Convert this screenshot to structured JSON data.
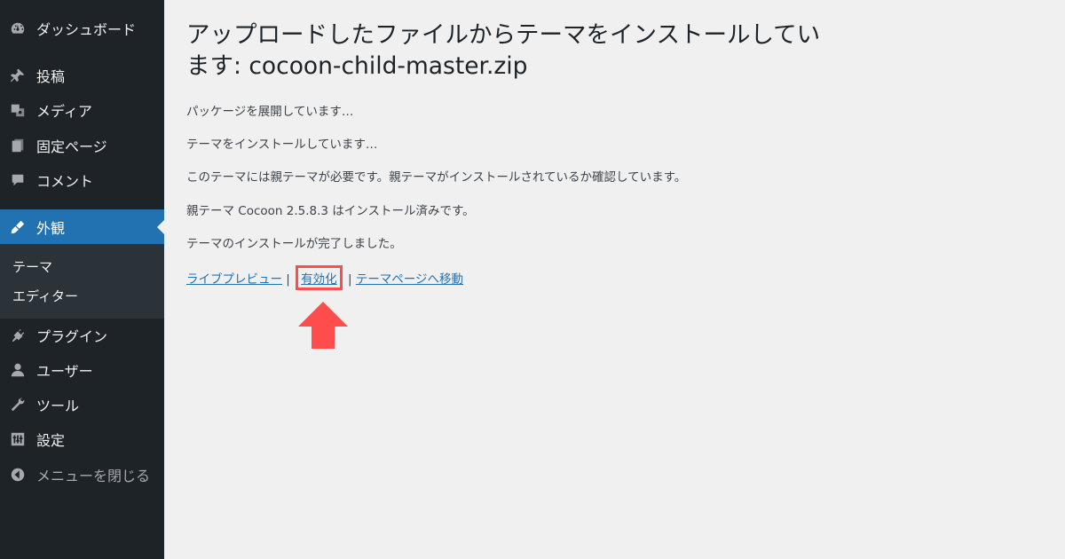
{
  "sidebar": {
    "items": [
      {
        "label": "ダッシュボード",
        "icon": "dashboard-icon"
      },
      {
        "label": "投稿",
        "icon": "pushpin-icon"
      },
      {
        "label": "メディア",
        "icon": "media-icon"
      },
      {
        "label": "固定ページ",
        "icon": "page-icon"
      },
      {
        "label": "コメント",
        "icon": "comment-icon"
      },
      {
        "label": "外観",
        "icon": "appearance-icon",
        "active": true
      },
      {
        "label": "プラグイン",
        "icon": "plugin-icon"
      },
      {
        "label": "ユーザー",
        "icon": "user-icon"
      },
      {
        "label": "ツール",
        "icon": "wrench-icon"
      },
      {
        "label": "設定",
        "icon": "settings-icon"
      },
      {
        "label": "メニューを閉じる",
        "icon": "collapse-icon"
      }
    ],
    "submenu": [
      {
        "label": "テーマ"
      },
      {
        "label": "エディター"
      }
    ]
  },
  "main": {
    "title": "アップロードしたファイルからテーマをインストールしています: cocoon-child-master.zip",
    "messages": [
      "パッケージを展開しています…",
      "テーマをインストールしています…",
      "このテーマには親テーマが必要です。親テーマがインストールされているか確認しています。",
      "親テーマ Cocoon 2.5.8.3 はインストール済みです。",
      "テーマのインストールが完了しました。"
    ],
    "links": {
      "live_preview": "ライブプレビュー",
      "activate": "有効化",
      "theme_page": "テーマページへ移動",
      "separator": "|"
    }
  },
  "colors": {
    "sidebar_bg": "#1d2327",
    "active_bg": "#2271b1",
    "link": "#2271b1",
    "highlight": "#ff4d4d"
  }
}
